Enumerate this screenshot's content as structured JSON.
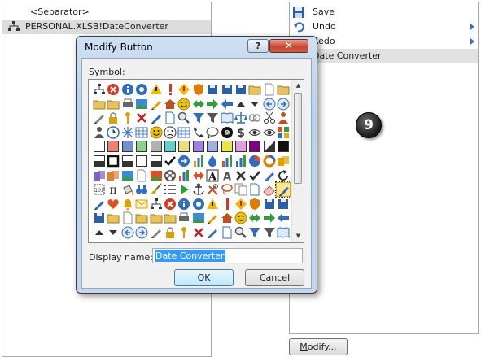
{
  "left_list": {
    "items": [
      {
        "label": "<Separator>"
      },
      {
        "label": "PERSONAL.XLSB!DateConverter"
      }
    ]
  },
  "right_list": {
    "items": [
      {
        "label": "Save",
        "icon": "save-icon"
      },
      {
        "label": "Undo",
        "icon": "undo-icon"
      },
      {
        "label": "Redo",
        "icon": "redo-icon"
      },
      {
        "label": "Date Converter",
        "icon": "macro-icon"
      }
    ],
    "step_badge": "9",
    "modify_button": {
      "prefix": "",
      "accel": "M",
      "suffix": "odify..."
    }
  },
  "dialog": {
    "title": "Modify Button",
    "help_label": "?",
    "close_label": "✕",
    "symbol_label": "Symbol:",
    "display_name_label": "Display name:",
    "display_name_value": "Date Converter",
    "ok_label": "OK",
    "cancel_label": "Cancel",
    "selected_symbol_index": 111
  },
  "colors": {
    "accent": "#3399ff",
    "title_bar": "#c4d7ef",
    "close_button": "#c8462d"
  }
}
